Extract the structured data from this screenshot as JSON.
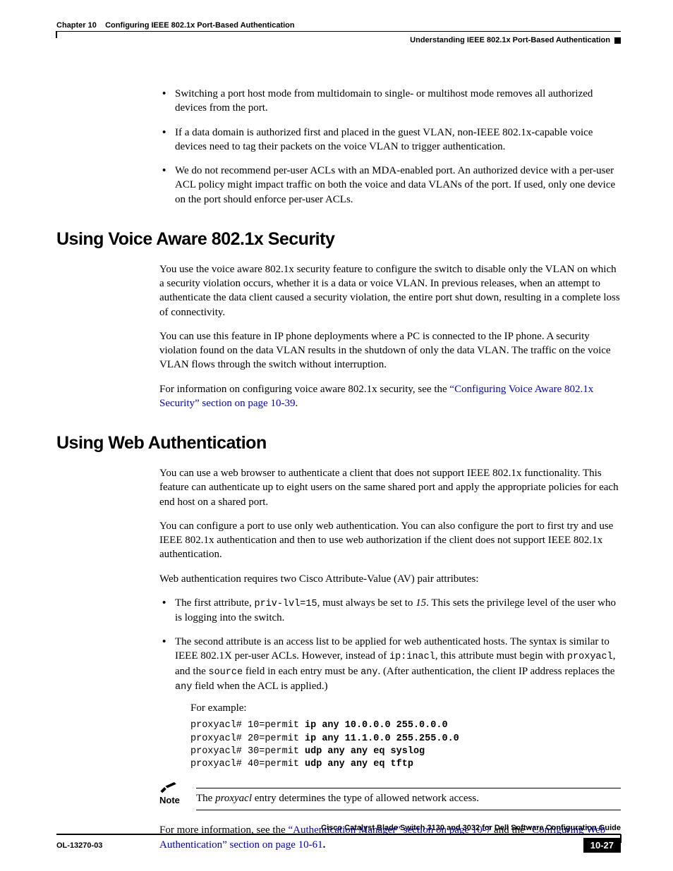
{
  "header": {
    "chapter_label": "Chapter 10",
    "chapter_title": "Configuring IEEE 802.1x Port-Based Authentication",
    "section_title": "Understanding IEEE 802.1x Port-Based Authentication"
  },
  "intro_bullets": [
    "Switching a port host mode from multidomain to single- or multihost mode removes all authorized devices from the port.",
    "If a data domain is authorized first and placed in the guest VLAN, non-IEEE 802.1x-capable voice devices need to tag their packets on the voice VLAN to trigger authentication.",
    "We do not recommend per-user ACLs with an MDA-enabled port. An authorized device with a per-user ACL policy might impact traffic on both the voice and data VLANs of the port. If used, only one device on the port should enforce per-user ACLs."
  ],
  "voice": {
    "heading": "Using Voice Aware 802.1x Security",
    "p1": "You use the voice aware 802.1x security feature to configure the switch to disable only the VLAN on which a security violation occurs, whether it is a data or voice VLAN. In previous releases, when an attempt to authenticate the data client caused a security violation, the entire port shut down, resulting in a complete loss of connectivity.",
    "p2": "You can use this feature in IP phone deployments where a PC is connected to the IP phone. A security violation found on the data VLAN results in the shutdown of only the data VLAN. The traffic on the voice VLAN flows through the switch without interruption.",
    "p3_lead": "For information on configuring voice aware 802.1x security, see the ",
    "p3_link": "“Configuring Voice Aware 802.1x Security” section on page 10-39",
    "p3_tail": "."
  },
  "web": {
    "heading": "Using Web Authentication",
    "p1": "You can use a web browser to authenticate a client that does not support IEEE 802.1x functionality. This feature can authenticate up to eight users on the same shared port and apply the appropriate policies for each end host on a shared port.",
    "p2": "You can configure a port to use only web authentication. You can also configure the port to first try and use IEEE 802.1x authentication and then to use web authorization if the client does not support IEEE 802.1x authentication.",
    "p3": "Web authentication requires two Cisco Attribute-Value (AV) pair attributes:",
    "b1_a": "The first attribute, ",
    "b1_code": "priv-lvl=15",
    "b1_b": ", must always be set to ",
    "b1_em": "15",
    "b1_c": ". This sets the privilege level of the user who is logging into the switch.",
    "b2_a": "The second attribute is an access list to be applied for web authenticated hosts.   The syntax is similar to IEEE 802.1X per-user ACLs. However, instead of ",
    "b2_code1": "ip:inacl",
    "b2_b": ", this attribute must begin with ",
    "b2_code2": "proxyacl",
    "b2_c": ", and the ",
    "b2_code3": "source",
    "b2_d": " field in each entry must be ",
    "b2_code4": "any",
    "b2_e": ".   (After authentication, the client IP address replaces the ",
    "b2_code5": "any",
    "b2_f": " field when the ACL is applied.)",
    "example_lead": "For example:",
    "code_lines": [
      {
        "pre": "proxyacl# 10=permit ",
        "bold": "ip any 10.0.0.0 255.0.0.0"
      },
      {
        "pre": "proxyacl# 20=permit ",
        "bold": "ip any 11.1.0.0 255.255.0.0"
      },
      {
        "pre": "proxyacl# 30=permit ",
        "bold": "udp any any eq syslog"
      },
      {
        "pre": "proxyacl# 40=permit ",
        "bold": "udp any any eq tftp"
      }
    ],
    "note_label": "Note",
    "note_a": "The ",
    "note_em": "proxyacl",
    "note_b": " entry determines the type of allowed network access.",
    "more_a": "For more information, see the ",
    "more_link1": "“Authentication Manager” section on page 10-7",
    "more_b": " and the ",
    "more_link2": "“Configuring Web Authentication” section on page 10-61",
    "more_c": "."
  },
  "footer": {
    "doc_title": "Cisco Catalyst Blade Switch 3130 and 3032 for Dell Software Configuration Guide",
    "doc_id": "OL-13270-03",
    "page_number": "10-27"
  }
}
